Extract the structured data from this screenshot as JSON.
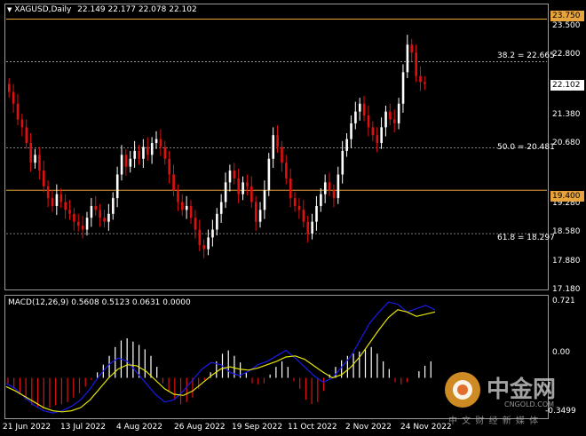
{
  "header": {
    "symbol": "XAGUSD,Daily",
    "ohlc": "22.149 22.177 22.078 22.102"
  },
  "macd_header": "MACD(12,26,9) 0.5608 0.5123 0.0631 0.0000",
  "price_axis": [
    "23.500",
    "22.800",
    "21.380",
    "20.680",
    "19.280",
    "18.580",
    "17.880",
    "17.180"
  ],
  "macd_axis": [
    "0.721",
    "0.00",
    "-0.3499"
  ],
  "tags": {
    "resistance": "23.750",
    "current": "22.102",
    "support": "19.400"
  },
  "fib_labels": [
    "38.2 = 22.665",
    "50.0 = 20.481",
    "61.8 = 18.297"
  ],
  "dates": [
    "21 Jun 2022",
    "13 Jul 2022",
    "4 Aug 2022",
    "26 Aug 2022",
    "19 Sep 2022",
    "11 Oct 2022",
    "2 Nov 2022",
    "24 Nov 2022"
  ],
  "watermark": {
    "brand": "中金网",
    "domain": "CNGOLD.COM",
    "tagline": "中 文 财 经 新 媒 体"
  },
  "colors": {
    "bull": "#ffffff",
    "bear": "#e01010",
    "level_line": "#e8a33a",
    "macd_line": "#1a1ae6",
    "signal_line": "#e6e60a",
    "tag_current_bg": "#ffffff"
  },
  "chart_data": {
    "type": "candlestick",
    "price_ylim": [
      16.9,
      24.1
    ],
    "horizontal_levels": [
      23.75,
      22.665,
      20.481,
      19.4,
      18.297
    ],
    "close_series": [
      21.9,
      21.6,
      21.2,
      21.0,
      20.6,
      20.1,
      20.3,
      19.9,
      19.5,
      19.2,
      19.0,
      19.3,
      19.1,
      18.9,
      18.8,
      18.6,
      18.5,
      18.4,
      18.7,
      19.0,
      18.9,
      18.7,
      18.6,
      18.8,
      19.2,
      19.8,
      20.3,
      20.0,
      20.2,
      20.4,
      20.2,
      20.5,
      20.3,
      20.6,
      20.7,
      20.5,
      20.2,
      19.8,
      19.4,
      19.1,
      18.9,
      19.0,
      18.7,
      18.4,
      18.0,
      17.9,
      18.2,
      18.4,
      18.8,
      19.1,
      19.6,
      19.9,
      19.7,
      19.3,
      19.6,
      19.5,
      19.1,
      18.6,
      18.9,
      19.4,
      20.2,
      20.8,
      20.5,
      20.1,
      19.7,
      19.2,
      19.0,
      18.9,
      18.6,
      18.3,
      18.6,
      19.0,
      19.3,
      19.6,
      19.4,
      19.2,
      19.8,
      20.4,
      20.7,
      21.1,
      21.4,
      21.6,
      21.3,
      21.0,
      20.8,
      20.6,
      21.0,
      21.4,
      21.2,
      21.1,
      21.6,
      22.4,
      23.1,
      22.9,
      22.3,
      22.15,
      22.1
    ],
    "macd_ylim": [
      -0.36,
      0.74
    ],
    "macd_histogram": [
      -0.05,
      -0.1,
      -0.15,
      -0.2,
      -0.25,
      -0.26,
      -0.28,
      -0.27,
      -0.25,
      -0.24,
      -0.22,
      -0.18,
      -0.14,
      -0.08,
      -0.02,
      0.05,
      0.12,
      0.2,
      0.28,
      0.34,
      0.36,
      0.33,
      0.3,
      0.26,
      0.2,
      0.1,
      -0.05,
      -0.12,
      -0.2,
      -0.24,
      -0.22,
      -0.18,
      -0.1,
      -0.02,
      0.05,
      0.15,
      0.22,
      0.25,
      0.2,
      0.14,
      0.05,
      -0.05,
      -0.06,
      -0.05,
      0.03,
      0.1,
      0.15,
      0.1,
      -0.03,
      -0.1,
      -0.2,
      -0.24,
      -0.22,
      -0.12,
      0.03,
      0.1,
      0.16,
      0.2,
      0.22,
      0.24,
      0.26,
      0.28,
      0.22,
      0.15,
      0.08,
      -0.04,
      -0.06,
      -0.04,
      0.0,
      0.06,
      0.11,
      0.15
    ],
    "macd_line": [
      -0.05,
      -0.1,
      -0.18,
      -0.25,
      -0.3,
      -0.32,
      -0.3,
      -0.26,
      -0.2,
      -0.1,
      0.02,
      0.12,
      0.18,
      0.15,
      0.05,
      -0.05,
      -0.15,
      -0.22,
      -0.2,
      -0.12,
      -0.02,
      0.08,
      0.14,
      0.12,
      0.05,
      0.02,
      0.06,
      0.12,
      0.15,
      0.2,
      0.25,
      0.18,
      0.1,
      0.02,
      -0.04,
      0.0,
      0.1,
      0.2,
      0.35,
      0.5,
      0.6,
      0.69,
      0.67,
      0.6,
      0.63,
      0.66,
      0.62
    ],
    "signal_line": [
      -0.08,
      -0.12,
      -0.17,
      -0.22,
      -0.27,
      -0.3,
      -0.31,
      -0.3,
      -0.27,
      -0.2,
      -0.1,
      0.0,
      0.08,
      0.12,
      0.11,
      0.06,
      -0.02,
      -0.1,
      -0.15,
      -0.16,
      -0.12,
      -0.05,
      0.02,
      0.08,
      0.1,
      0.08,
      0.07,
      0.09,
      0.12,
      0.15,
      0.19,
      0.2,
      0.17,
      0.11,
      0.05,
      0.0,
      0.03,
      0.1,
      0.2,
      0.32,
      0.44,
      0.55,
      0.62,
      0.6,
      0.56,
      0.58,
      0.6
    ]
  }
}
